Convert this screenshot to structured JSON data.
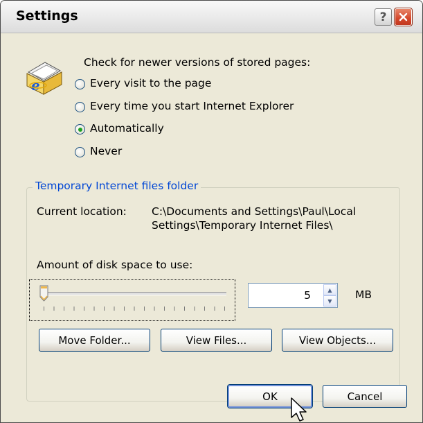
{
  "window": {
    "title": "Settings",
    "help_button": "?",
    "close_button": "✕"
  },
  "check_section": {
    "heading": "Check for newer versions of stored pages:",
    "icon": "ie-cached-pages-icon",
    "options": [
      {
        "label": "Every visit to the page",
        "accel": "E",
        "checked": false
      },
      {
        "label": "Every time you start Internet Explorer",
        "accel": "s",
        "checked": false
      },
      {
        "label": "Automatically",
        "accel": "A",
        "checked": true
      },
      {
        "label": "Never",
        "accel": "N",
        "checked": false
      }
    ]
  },
  "temp_folder": {
    "legend": "Temporary Internet files folder",
    "current_location_label": "Current location:",
    "current_location_line1": "C:\\Documents and Settings\\Paul\\Local",
    "current_location_line2": "Settings\\Temporary Internet Files\\",
    "disk_space_label": "Amount of disk space to use:",
    "disk_space_accel": "d",
    "disk_space_value": "5",
    "disk_space_unit": "MB",
    "slider_level": 0,
    "buttons": [
      {
        "label": "Move Folder...",
        "accel": "M"
      },
      {
        "label": "View Files...",
        "accel": "V"
      },
      {
        "label": "View Objects...",
        "accel": "O"
      }
    ]
  },
  "dialog_buttons": {
    "ok": "OK",
    "cancel": "Cancel"
  },
  "colors": {
    "face": "#ece9d8",
    "legend": "#0046d5",
    "radio_check": "#21a121",
    "close": "#d4472b"
  }
}
